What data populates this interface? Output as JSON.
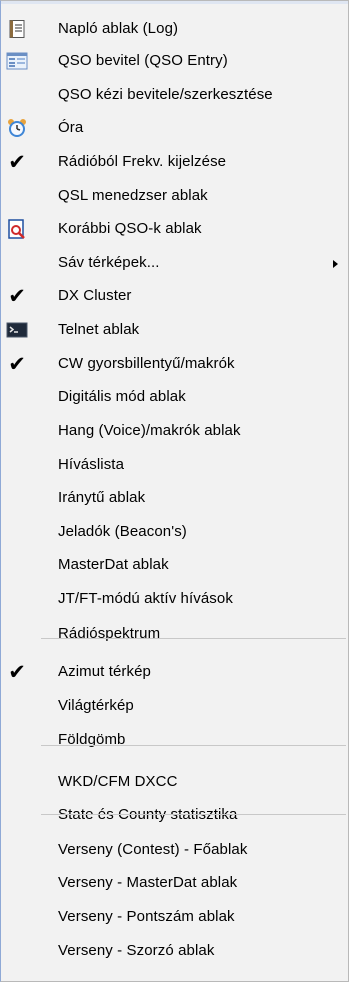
{
  "menu": {
    "items": [
      {
        "label": "Napló ablak (Log)",
        "icon": "log-notebook-icon",
        "checked": false
      },
      {
        "label": "QSO bevitel (QSO Entry)",
        "icon": "entry-form-icon",
        "checked": false
      },
      {
        "label": "QSO kézi bevitele/szerkesztése",
        "icon": "",
        "checked": false
      },
      {
        "label": "Óra",
        "icon": "alarm-clock-icon",
        "checked": false
      },
      {
        "label": "Rádióból Frekv. kijelzése",
        "icon": "",
        "checked": true
      },
      {
        "label": "QSL menedzser ablak",
        "icon": "",
        "checked": false
      },
      {
        "label": "Korábbi QSO-k ablak",
        "icon": "document-search-icon",
        "checked": false
      },
      {
        "label": "Sáv térképek...",
        "icon": "",
        "checked": false,
        "submenu": true
      },
      {
        "label": "DX Cluster",
        "icon": "",
        "checked": true
      },
      {
        "label": "Telnet ablak",
        "icon": "terminal-window-icon",
        "checked": false
      },
      {
        "label": "CW gyorsbillentyű/makrók",
        "icon": "",
        "checked": true
      },
      {
        "label": "Digitális mód ablak",
        "icon": "",
        "checked": false
      },
      {
        "label": "Hang (Voice)/makrók ablak",
        "icon": "",
        "checked": false
      },
      {
        "label": "Híváslista",
        "icon": "",
        "checked": false
      },
      {
        "label": "Iránytű ablak",
        "icon": "",
        "checked": false
      },
      {
        "label": "Jeladók (Beacon's)",
        "icon": "",
        "checked": false
      },
      {
        "label": "MasterDat ablak",
        "icon": "",
        "checked": false
      },
      {
        "label": "JT/FT-módú aktív hívások",
        "icon": "",
        "checked": false
      },
      {
        "label": "Rádióspektrum",
        "icon": "",
        "checked": false
      },
      {
        "label": "Azimut térkép",
        "icon": "",
        "checked": true
      },
      {
        "label": "Világtérkép",
        "icon": "",
        "checked": false
      },
      {
        "label": "Földgömb",
        "icon": "",
        "checked": false
      },
      {
        "label": "WKD/CFM DXCC",
        "icon": "",
        "checked": false
      },
      {
        "label": "State és County statisztika",
        "icon": "",
        "checked": false
      },
      {
        "label": "Verseny (Contest) - Főablak",
        "icon": "",
        "checked": false
      },
      {
        "label": "Verseny - MasterDat ablak",
        "icon": "",
        "checked": false
      },
      {
        "label": "Verseny - Pontszám ablak",
        "icon": "",
        "checked": false
      },
      {
        "label": "Verseny - Szorzó ablak",
        "icon": "",
        "checked": false
      }
    ]
  },
  "colors": {
    "menu_background": "#f2f2f2",
    "separator": "#c8c8c8",
    "check": "#000000"
  }
}
